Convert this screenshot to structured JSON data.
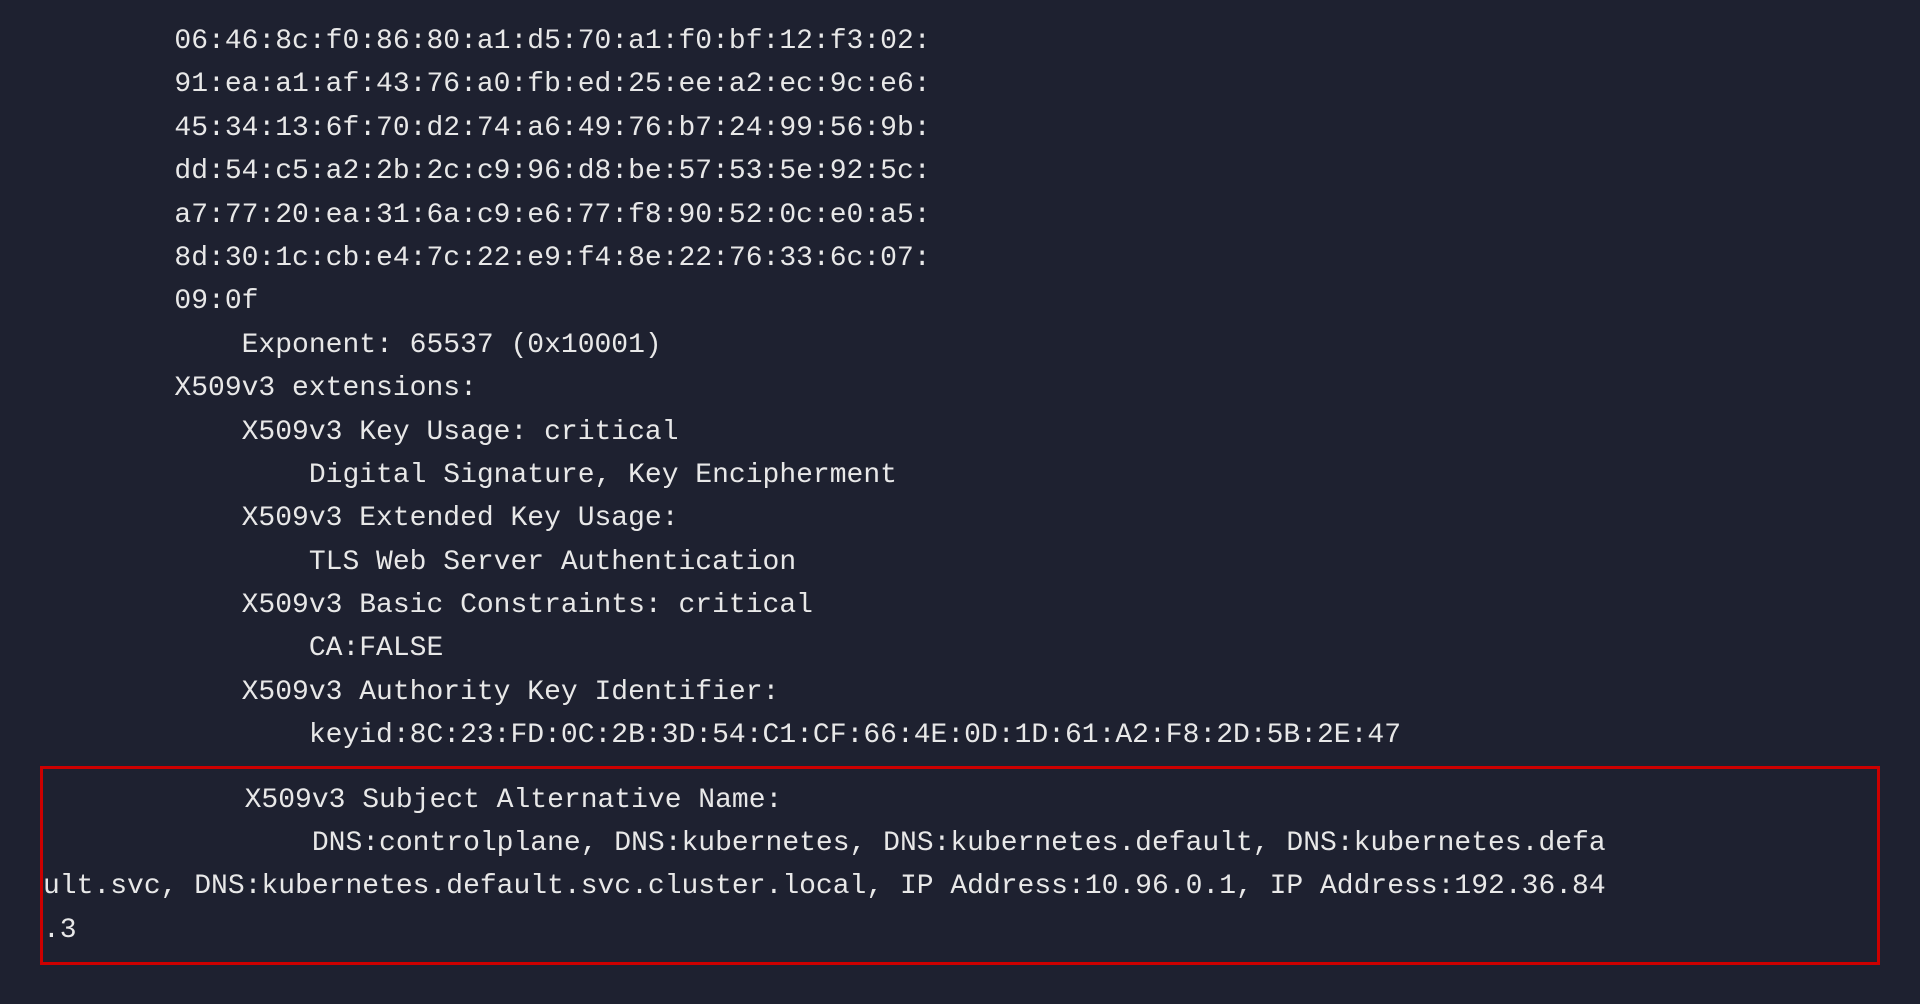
{
  "terminal": {
    "lines_above": [
      "        06:46:8c:f0:86:80:a1:d5:70:a1:f0:bf:12:f3:02:",
      "        91:ea:a1:af:43:76:a0:fb:ed:25:ee:a2:ec:9c:e6:",
      "        45:34:13:6f:70:d2:74:a6:49:76:b7:24:99:56:9b:",
      "        dd:54:c5:a2:2b:2c:c9:96:d8:be:57:53:5e:92:5c:",
      "        a7:77:20:ea:31:6a:c9:e6:77:f8:90:52:0c:e0:a5:",
      "        8d:30:1c:cb:e4:7c:22:e9:f4:8e:22:76:33:6c:07:",
      "        09:0f",
      "            Exponent: 65537 (0x10001)",
      "        X509v3 extensions:",
      "            X509v3 Key Usage: critical",
      "                Digital Signature, Key Encipherment",
      "            X509v3 Extended Key Usage:",
      "                TLS Web Server Authentication",
      "            X509v3 Basic Constraints: critical",
      "                CA:FALSE",
      "            X509v3 Authority Key Identifier:",
      "                keyid:8C:23:FD:0C:2B:3D:54:C1:CF:66:4E:0D:1D:61:A2:F8:2D:5B:2E:47"
    ],
    "highlighted_lines": [
      "            X509v3 Subject Alternative Name:",
      "                DNS:controlplane, DNS:kubernetes, DNS:kubernetes.default, DNS:kubernetes.defa",
      "ult.svc, DNS:kubernetes.default.svc.cluster.local, IP Address:10.96.0.1, IP Address:192.36.84",
      ".3"
    ],
    "highlight_border_color": "#cc0000"
  }
}
